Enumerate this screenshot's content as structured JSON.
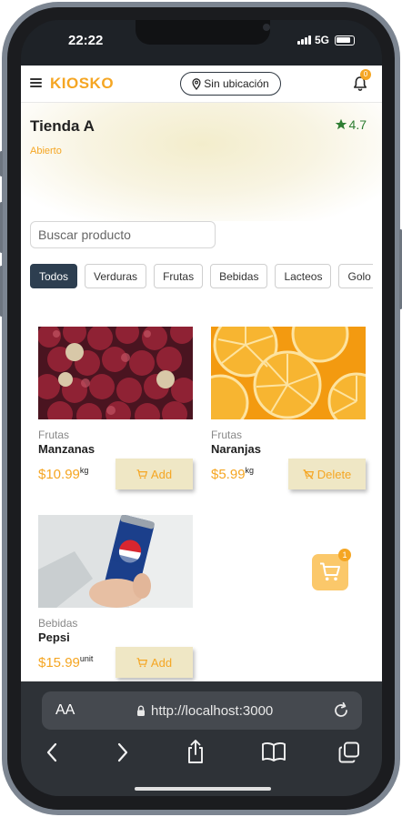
{
  "status_bar": {
    "time": "22:22",
    "network": "5G"
  },
  "header": {
    "brand": "KIOSKO",
    "location_label": "Sin ubicación",
    "notification_count": "0"
  },
  "store": {
    "name": "Tienda A",
    "status": "Abierto",
    "rating": "4.7"
  },
  "search": {
    "placeholder": "Buscar producto"
  },
  "categories": [
    "Todos",
    "Verduras",
    "Frutas",
    "Bebidas",
    "Lacteos",
    "Golo"
  ],
  "products": [
    {
      "category": "Frutas",
      "name": "Manzanas",
      "price": "$10.99",
      "unit": "kg",
      "action": "Add",
      "image": "red-apples"
    },
    {
      "category": "Frutas",
      "name": "Naranjas",
      "price": "$5.99",
      "unit": "kg",
      "action": "Delete",
      "image": "orange-slices"
    },
    {
      "category": "Bebidas",
      "name": "Pepsi",
      "price": "$15.99",
      "unit": "unit",
      "action": "Add",
      "image": "pepsi-can"
    }
  ],
  "cart": {
    "count": "1"
  },
  "browser": {
    "aa_label": "AA",
    "url": "http://localhost:3000"
  },
  "colors": {
    "accent": "#f5a623",
    "active_chip": "#2d3e50",
    "button_bg": "#efe7c5",
    "rating": "#2e7d32"
  }
}
